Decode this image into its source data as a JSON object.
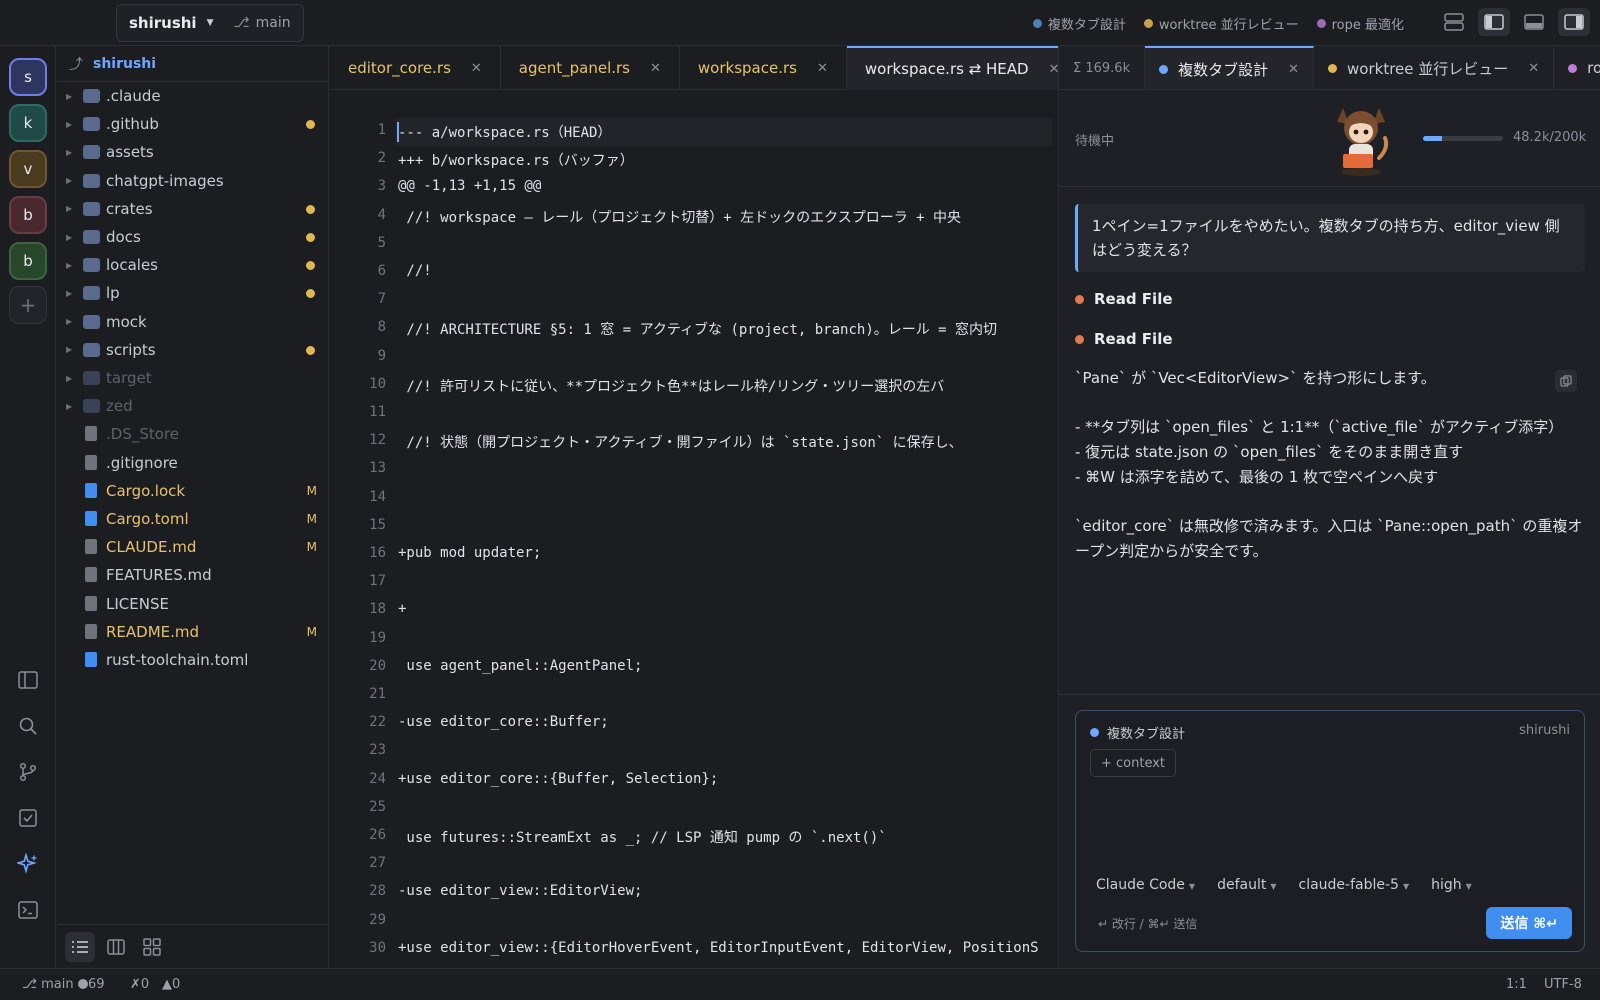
{
  "titlebar": {
    "project": "shirushi",
    "branch": "main",
    "chips": [
      {
        "label": "複数タブ設計",
        "color": "#4f7fb8"
      },
      {
        "label": "worktree 並行レビュー",
        "color": "#c9a24a"
      },
      {
        "label": "rope 最適化",
        "color": "#9b6bb8"
      }
    ]
  },
  "rail": {
    "projects": [
      {
        "letter": "s",
        "bg": "#2e3560",
        "border": "#6f7fe8"
      },
      {
        "letter": "k",
        "bg": "#1f4a45",
        "border": "#2e6a63"
      },
      {
        "letter": "v",
        "bg": "#4a3a1e",
        "border": "#6e5630"
      },
      {
        "letter": "b",
        "bg": "#4a2830",
        "border": "#6a3a45"
      },
      {
        "letter": "b",
        "bg": "#28462a",
        "border": "#3c6640"
      }
    ],
    "add": "+"
  },
  "explorer": {
    "root": "shirushi",
    "items": [
      {
        "name": ".claude",
        "type": "folder",
        "dot": false
      },
      {
        "name": ".github",
        "type": "folder",
        "dot": true
      },
      {
        "name": "assets",
        "type": "folder",
        "dot": false
      },
      {
        "name": "chatgpt-images",
        "type": "folder",
        "dot": false
      },
      {
        "name": "crates",
        "type": "folder",
        "dot": true
      },
      {
        "name": "docs",
        "type": "folder",
        "dot": true
      },
      {
        "name": "locales",
        "type": "folder",
        "dot": true
      },
      {
        "name": "lp",
        "type": "folder",
        "dot": true
      },
      {
        "name": "mock",
        "type": "folder",
        "dot": false
      },
      {
        "name": "scripts",
        "type": "folder",
        "dot": true
      },
      {
        "name": "target",
        "type": "folder",
        "dim": true
      },
      {
        "name": "zed",
        "type": "folder",
        "dim": true
      },
      {
        "name": ".DS_Store",
        "type": "file",
        "dim": true
      },
      {
        "name": ".gitignore",
        "type": "file"
      },
      {
        "name": "Cargo.lock",
        "type": "file",
        "blue": true,
        "badge": "M"
      },
      {
        "name": "Cargo.toml",
        "type": "file",
        "blue": true,
        "badge": "M"
      },
      {
        "name": "CLAUDE.md",
        "type": "file",
        "badge": "M"
      },
      {
        "name": "FEATURES.md",
        "type": "file"
      },
      {
        "name": "LICENSE",
        "type": "file"
      },
      {
        "name": "README.md",
        "type": "file",
        "badge": "M"
      },
      {
        "name": "rust-toolchain.toml",
        "type": "file",
        "blue": true
      }
    ]
  },
  "editor": {
    "tabs": [
      {
        "label": "editor_core.rs",
        "active": false
      },
      {
        "label": "agent_panel.rs",
        "active": false
      },
      {
        "label": "workspace.rs",
        "active": false
      },
      {
        "label": "workspace.rs ⇄ HEAD",
        "active": true
      }
    ],
    "lines": [
      "--- a/workspace.rs（HEAD）",
      "+++ b/workspace.rs（バッファ）",
      "@@ -1,13 +1,15 @@",
      " //! workspace — レール（プロジェクト切替）+ 左ドックのエクスプローラ + 中央",
      "",
      " //!",
      "",
      " //! ARCHITECTURE §5: 1 窓 = アクティブな (project, branch)。レール = 窓内切",
      "",
      " //! 許可リストに従い、**プロジェクト色**はレール枠/リング・ツリー選択の左バ",
      "",
      " //! 状態（開プロジェクト・アクティブ・開ファイル）は `state.json` に保存し、",
      "",
      "",
      "",
      "+pub mod updater;",
      "",
      "+",
      "",
      " use agent_panel::AgentPanel;",
      "",
      "-use editor_core::Buffer;",
      "",
      "+use editor_core::{Buffer, Selection};",
      "",
      " use futures::StreamExt as _; // LSP 通知 pump の `.next()`",
      "",
      "-use editor_view::EditorView;",
      "",
      "+use editor_view::{EditorHoverEvent, EditorInputEvent, EditorView, PositionS"
    ]
  },
  "agent": {
    "token_sum": "Σ 169.6k",
    "tabs": [
      {
        "label": "複数タブ設計",
        "color": "#6ea8ff",
        "active": true
      },
      {
        "label": "worktree 並行レビュー",
        "color": "#e0b84f",
        "active": false
      },
      {
        "label": "ro",
        "color": "#c07ad8",
        "active": false
      }
    ],
    "status": "待機中",
    "context_used": "48.2k/200k",
    "context_fraction": 0.241,
    "user_message": "1ペイン=1ファイルをやめたい。複数タブの持ち方、editor_view 側はどう変える？",
    "tool_calls": [
      "Read File",
      "Read File"
    ],
    "reply": [
      "`Pane` が `Vec<EditorView>` を持つ形にします。",
      "",
      "- **タブ列は `open_files` と 1:1**（`active_file` がアクティブ添字）",
      "- 復元は state.json の `open_files` をそのまま開き直す",
      "- ⌘W は添字を詰めて、最後の 1 枚で空ペインへ戻す",
      "",
      "`editor_core` は無改修で済みます。入口は `Pane::open_path` の重複オープン判定からが安全です。"
    ],
    "composer": {
      "thread": "複数タブ設計",
      "project": "shirushi",
      "context_button": "+ context",
      "options": [
        "Claude Code",
        "default",
        "claude-fable-5",
        "high"
      ],
      "hint": "↵ 改行 / ⌘↵ 送信",
      "send": "送信 ⌘↵"
    }
  },
  "statusbar": {
    "branch": "main",
    "changes": "69",
    "errors": "0",
    "warnings": "0",
    "position": "1:1",
    "encoding": "UTF-8"
  }
}
